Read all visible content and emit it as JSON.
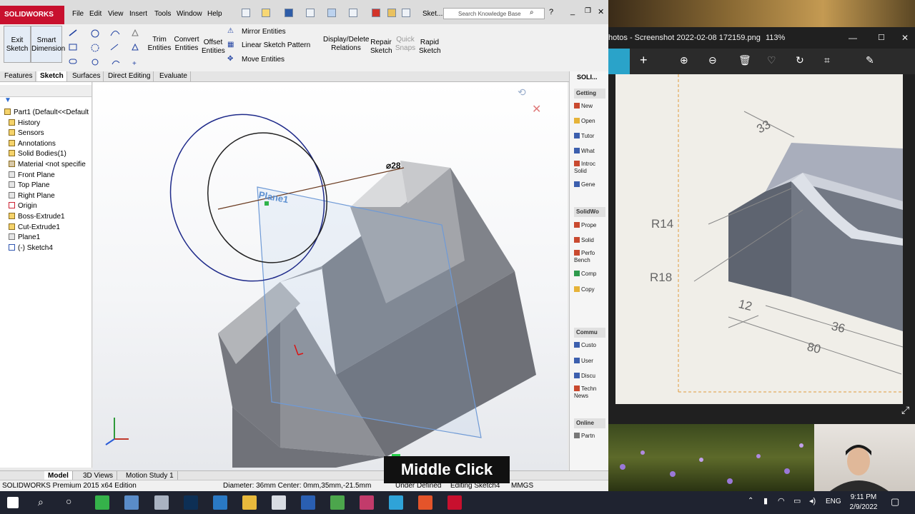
{
  "solidworks": {
    "logo": "SOLIDWORKS",
    "menu": [
      "File",
      "Edit",
      "View",
      "Insert",
      "Tools",
      "Window",
      "Help"
    ],
    "sketch_tab_label": "Sket...",
    "search_placeholder": "Search Knowledge Base",
    "cmd": {
      "exit_sketch": "Exit Sketch",
      "smart_dimension": "Smart Dimension",
      "trim_entities": "Trim Entities",
      "convert_entities": "Convert Entities",
      "offset_entities": "Offset Entities",
      "mirror_entities": "Mirror Entities",
      "linear_sketch_pattern": "Linear Sketch Pattern",
      "move_entities": "Move Entities",
      "display_delete_relations": "Display/Delete Relations",
      "repair_sketch": "Repair Sketch",
      "quick_snaps": "Quick Snaps",
      "rapid_sketch": "Rapid Sketch"
    },
    "tabs": [
      "Features",
      "Sketch",
      "Surfaces",
      "Direct Editing",
      "Evaluate"
    ],
    "active_tab": "Sketch",
    "tree": {
      "root": "Part1  (Default<<Default",
      "items": [
        "History",
        "Sensors",
        "Annotations",
        "Solid Bodies(1)",
        "Material <not specifie",
        "Front Plane",
        "Top Plane",
        "Right Plane",
        "Origin",
        "Boss-Extrude1",
        "Cut-Extrude1",
        "Plane1",
        "(-) Sketch4"
      ]
    },
    "viewport": {
      "plane_label": "Plane1",
      "dimension_label": "⌀28"
    },
    "taskpane": {
      "title": "SOLI...",
      "getting_started": "Getting",
      "getting_items": [
        "New",
        "Open",
        "Tutor",
        "What",
        "Introc Solid",
        "Gene"
      ],
      "solidworks_head": "SolidWo",
      "solidworks_items": [
        "Prope",
        "Solid",
        "Perfo Bench",
        "Comp",
        "Copy"
      ],
      "community_head": "Commu",
      "community_items": [
        "Custo",
        "User",
        "Discu",
        "Techn News"
      ],
      "online_head": "Online",
      "online_items": [
        "Partn"
      ]
    },
    "bottom_tabs": [
      "Model",
      "3D Views",
      "Motion Study 1"
    ],
    "status": {
      "edition": "SOLIDWORKS Premium 2015 x64 Edition",
      "info": "Diameter: 36mm  Center: 0mm,35mm,-21.5mm",
      "state": "Under Defined",
      "editing": "Editing Sketch4",
      "units": "MMGS"
    }
  },
  "photos": {
    "title": "hotos - Screenshot 2022-02-08 172159.png",
    "zoom": "113%",
    "drawing": {
      "dim_33": "33",
      "r14": "R14",
      "r18": "R18",
      "dim_12": "12",
      "dim_36": "36",
      "dim_80": "80"
    }
  },
  "overlay": {
    "middle_click": "Middle Click"
  },
  "taskbar": {
    "lang": "ENG",
    "time": "9:11 PM",
    "date": "2/9/2022"
  },
  "colors": {
    "sw_red": "#c8102e",
    "sketch_blue": "#1e2a8a",
    "plane_blue": "#5b8fd1",
    "body_gray": "#7c7f86",
    "taskbar": "#1f2330"
  }
}
